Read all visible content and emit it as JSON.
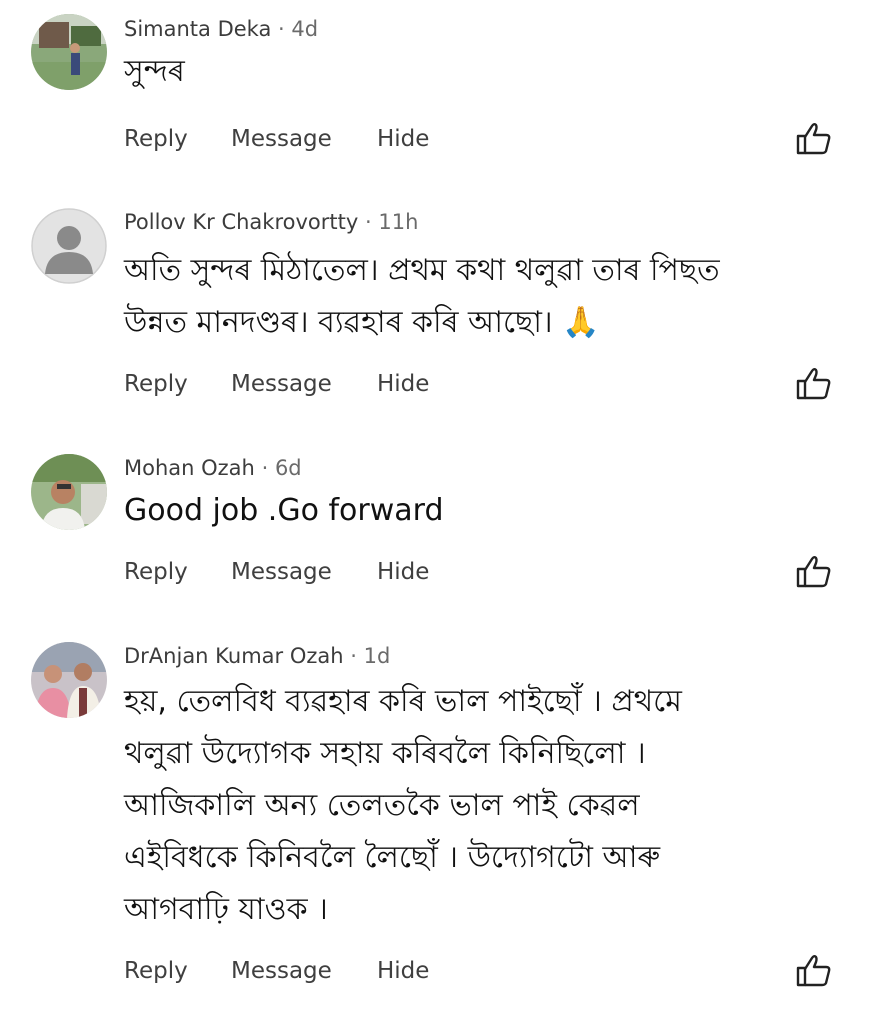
{
  "comments": [
    {
      "author": "Simanta Deka",
      "separator": "·",
      "time": "4d",
      "lines": [
        "সুন্দৰ"
      ],
      "avatar_icon": "user-photo",
      "actions": {
        "reply": "Reply",
        "message": "Message",
        "hide": "Hide"
      },
      "like_icon": "thumbs-up-outline"
    },
    {
      "author": "Pollov Kr Chakrovortty",
      "separator": "·",
      "time": "11h",
      "lines": [
        "অতি সুন্দৰ মিঠাতেল। প্ৰথম কথা থলুৱা তাৰ পিছত",
        "উন্নত মানদণ্ডৰ। ব্যৱহাৰ কৰি আছো। 🙏"
      ],
      "avatar_icon": "default-user-silhouette",
      "actions": {
        "reply": "Reply",
        "message": "Message",
        "hide": "Hide"
      },
      "like_icon": "thumbs-up-outline"
    },
    {
      "author": "Mohan Ozah",
      "separator": "·",
      "time": "6d",
      "lines": [
        "Good job .Go forward"
      ],
      "avatar_icon": "user-photo",
      "actions": {
        "reply": "Reply",
        "message": "Message",
        "hide": "Hide"
      },
      "like_icon": "thumbs-up-outline"
    },
    {
      "author": "DrAnjan Kumar Ozah",
      "separator": "·",
      "time": "1d",
      "lines": [
        "হয়, তেলবিধ ব্যৱহাৰ কৰি ভাল পাইছোঁ । প্ৰথমে",
        "থলুৱা উদ্যোগক সহায় কৰিবলৈ কিনিছিলো ।",
        "আজিকালি অন্য তেলতকৈ ভাল পাই কেৱল",
        "এইবিধকে কিনিবলৈ লৈছোঁ । উদ্যোগটো আৰু",
        "আগবাঢ়ি যাওক ।"
      ],
      "avatar_icon": "user-photo",
      "actions": {
        "reply": "Reply",
        "message": "Message",
        "hide": "Hide"
      },
      "like_icon": "thumbs-up-outline"
    }
  ]
}
